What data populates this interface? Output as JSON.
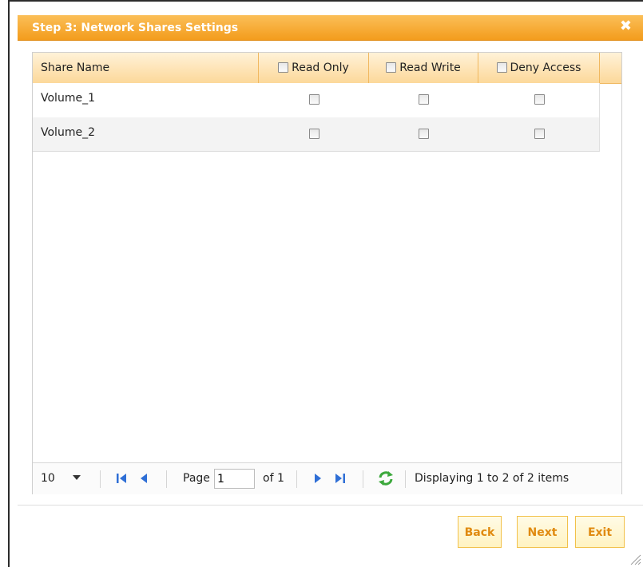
{
  "dialog": {
    "title": "Step 3: Network Shares Settings",
    "close_glyph": "✖"
  },
  "grid": {
    "columns": {
      "share_name": "Share Name",
      "read_only": "Read Only",
      "read_write": "Read Write",
      "deny_access": "Deny Access"
    },
    "rows": [
      {
        "name": "Volume_1",
        "read_only": false,
        "read_write": false,
        "deny_access": false
      },
      {
        "name": "Volume_2",
        "read_only": false,
        "read_write": false,
        "deny_access": false
      }
    ]
  },
  "pager": {
    "page_size": "10",
    "page_label": "Page",
    "page_value": "1",
    "of_label": "of 1",
    "display_text": "Displaying 1 to 2 of 2 items",
    "icons": [
      "first-page-icon",
      "prev-page-icon",
      "next-page-icon",
      "last-page-icon",
      "refresh-icon"
    ]
  },
  "buttons": {
    "back": "Back",
    "next": "Next",
    "exit": "Exit"
  },
  "colors": {
    "titlebar": "#f5a623",
    "header_bg": "#fde3b0",
    "button_text": "#e08a10",
    "nav_arrow": "#2f6fd6",
    "refresh": "#3ca83c"
  }
}
